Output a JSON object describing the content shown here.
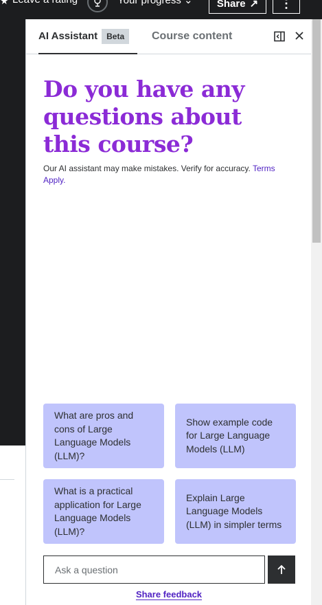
{
  "topbar": {
    "rating_label": "Leave a rating",
    "progress_label": "Your progress",
    "share_label": "Share"
  },
  "tabs": {
    "ai_assistant": "AI Assistant",
    "beta_badge": "Beta",
    "course_content": "Course content"
  },
  "headline": "Do you have any questions about this course?",
  "disclaimer": {
    "text": "Our AI assistant may make mistakes. Verify for accuracy. ",
    "link": "Terms Apply."
  },
  "suggestions": [
    "What are pros and cons of Large Language Models (LLM)?",
    "Show example code for Large Language Models (LLM)",
    "What is a practical application for Large Language Models (LLM)?",
    "Explain Large Language Models (LLM) in simpler terms"
  ],
  "ask": {
    "placeholder": "Ask a question"
  },
  "feedback_label": "Share feedback",
  "colors": {
    "accent": "#8b2bd6",
    "suggestion_bg": "#c0c4fc",
    "dark": "#1c1d1f",
    "link": "#5022c3"
  }
}
